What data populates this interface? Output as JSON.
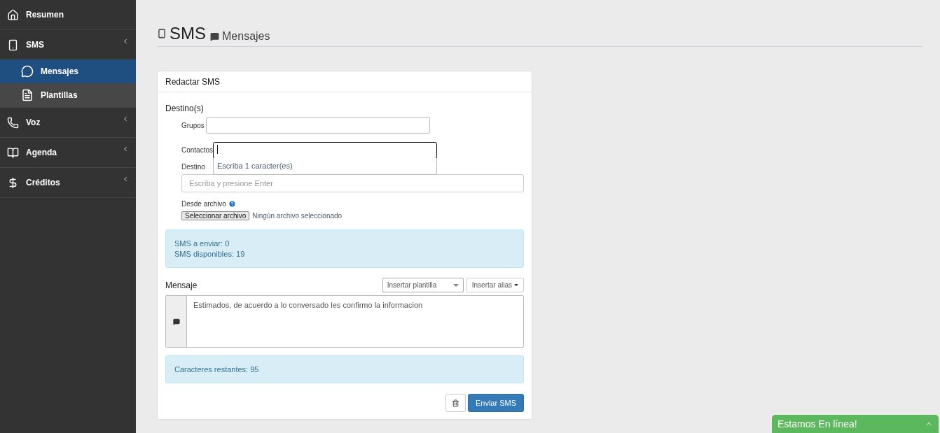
{
  "sidebar": {
    "items": [
      {
        "label": "Resumen",
        "kind": "link"
      },
      {
        "label": "SMS",
        "kind": "menu",
        "children": [
          {
            "label": "Mensajes",
            "selected": true
          },
          {
            "label": "Plantillas",
            "selected": false
          }
        ]
      },
      {
        "label": "Voz",
        "kind": "menu"
      },
      {
        "label": "Agenda",
        "kind": "menu"
      },
      {
        "label": "Créditos",
        "kind": "menu"
      }
    ]
  },
  "header": {
    "title": "SMS",
    "subtitle": "Mensajes"
  },
  "card": {
    "title": "Redactar SMS",
    "destinations_label": "Destino(s)",
    "groups": {
      "label": "Grupos"
    },
    "contacts": {
      "label": "Contactos",
      "hint": "Escriba 1 caracter(es)"
    },
    "destination": {
      "label": "Destino",
      "placeholder": "Escriba y presione Enter"
    },
    "file": {
      "label": "Desde archivo",
      "button": "Seleccionar archivo",
      "status": "Ningún archivo seleccionado"
    },
    "counts": [
      "SMS a enviar: 0",
      "SMS disponibles: 19"
    ],
    "message_label": "Mensaje",
    "template_select": "Insertar plantilla",
    "alias_button": "Insertar alias",
    "message": "Estimados, de acuerdo a lo conversado les confirmo la informacion",
    "remaining": "Caracteres restantes: 95",
    "send_button": "Enviar SMS"
  },
  "chat_widget": {
    "title": "Estamos En línea!"
  }
}
